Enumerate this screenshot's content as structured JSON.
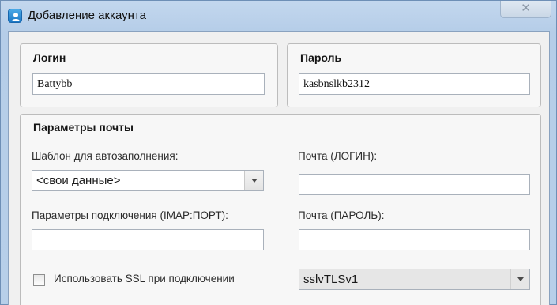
{
  "window": {
    "title": "Добавление аккаунта",
    "close_glyph": "✕",
    "app_icon": "account-app-icon"
  },
  "login_group": {
    "title": "Логин",
    "value": "Battybb"
  },
  "password_group": {
    "title": "Пароль",
    "value": "kasbnslkb2312"
  },
  "mail_params": {
    "title": "Параметры почты",
    "template_label": "Шаблон для автозаполнения:",
    "template_value": "<свои данные>",
    "connection_label": "Параметры подключения (IMAP:ПОРТ):",
    "connection_value": "",
    "mail_login_label": "Почта (ЛОГИН):",
    "mail_login_value": "",
    "mail_password_label": "Почта (ПАРОЛЬ):",
    "mail_password_value": "",
    "ssl_checkbox_label": "Использовать SSL при подключении",
    "ssl_checked": false,
    "ssl_method_value": "sslvTLSv1"
  },
  "colors": {
    "window_frame": "#b9d1ea",
    "client_bg": "#f0f0f0",
    "textbox_border": "#a9b1bb"
  }
}
